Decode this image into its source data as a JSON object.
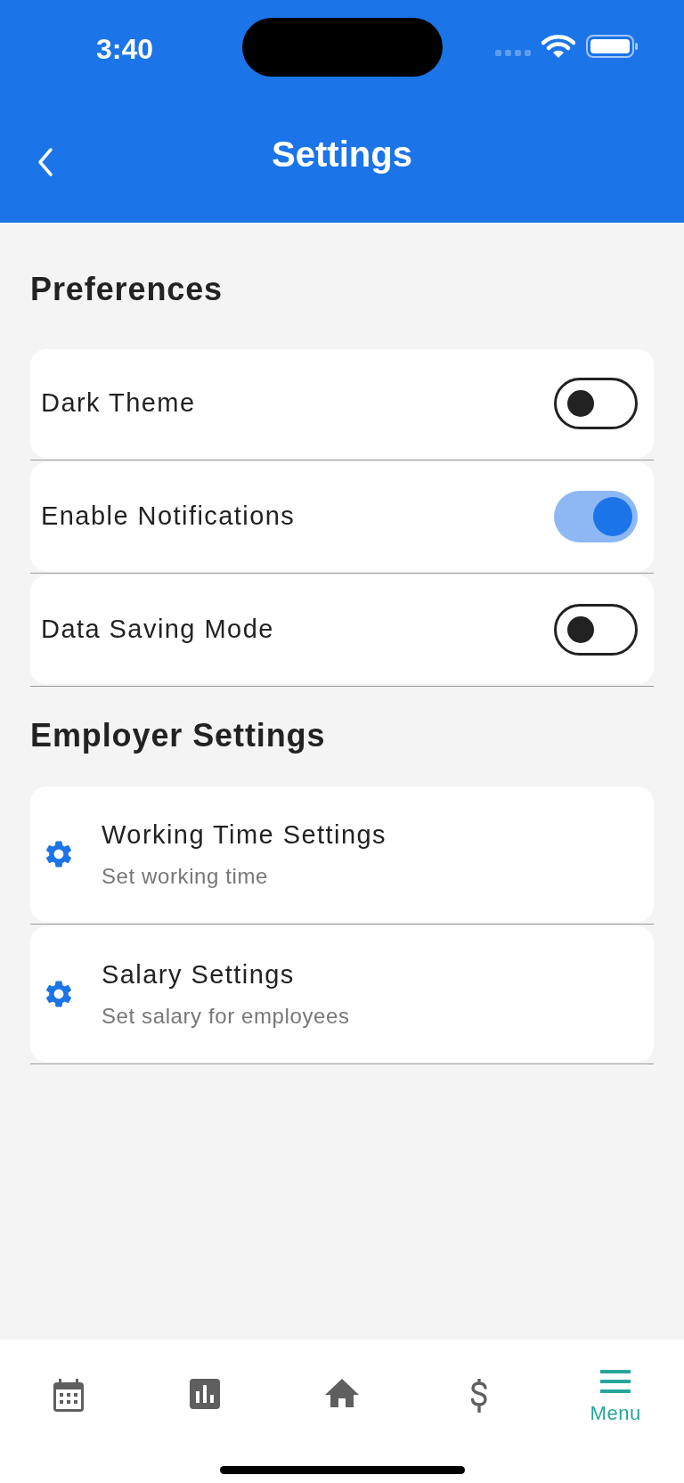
{
  "status_bar": {
    "time": "3:40"
  },
  "header": {
    "title": "Settings"
  },
  "sections": [
    {
      "title": "Preferences",
      "items": [
        {
          "kind": "toggle",
          "label": "Dark Theme",
          "on": false
        },
        {
          "kind": "toggle",
          "label": "Enable Notifications",
          "on": true
        },
        {
          "kind": "toggle",
          "label": "Data Saving Mode",
          "on": false
        }
      ]
    },
    {
      "title": "Employer Settings",
      "items": [
        {
          "kind": "link",
          "label": "Working Time Settings",
          "subtitle": "Set working time"
        },
        {
          "kind": "link",
          "label": "Salary Settings",
          "subtitle": "Set salary for employees"
        }
      ]
    }
  ],
  "bottom_nav": [
    {
      "kind": "calendar",
      "selected": false
    },
    {
      "kind": "chart",
      "selected": false
    },
    {
      "kind": "home",
      "selected": false
    },
    {
      "kind": "dollar",
      "selected": false
    },
    {
      "kind": "menu",
      "label": "Menu",
      "selected": true
    }
  ]
}
